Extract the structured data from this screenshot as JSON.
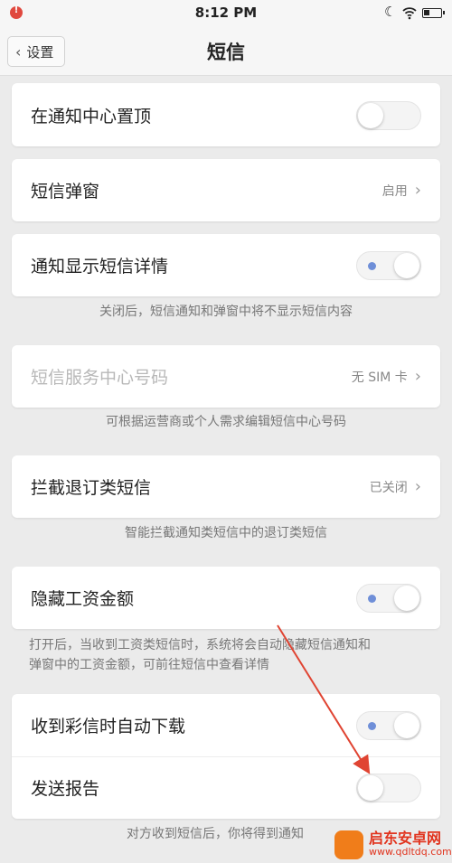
{
  "status_bar": {
    "time": "8:12 PM",
    "icons": [
      "notification-icon",
      "moon-icon",
      "wifi-icon",
      "battery-icon"
    ]
  },
  "nav": {
    "back_label": "设置",
    "title": "短信"
  },
  "settings": {
    "pin_top": {
      "label": "在通知中心置顶",
      "toggle": "off"
    },
    "popup": {
      "label": "短信弹窗",
      "value": "启用"
    },
    "show_details": {
      "label": "通知显示短信详情",
      "toggle": "on",
      "hint": "关闭后，短信通知和弹窗中将不显示短信内容"
    },
    "service_center": {
      "label": "短信服务中心号码",
      "value": "无 SIM 卡",
      "hint": "可根据运营商或个人需求编辑短信中心号码"
    },
    "block_unsubscribe": {
      "label": "拦截退订类短信",
      "value": "已关闭",
      "hint": "智能拦截通知类短信中的退订类短信"
    },
    "hide_salary": {
      "label": "隐藏工资金额",
      "toggle": "on",
      "hint_line1": "打开后，当收到工资类短信时，系统将会自动隐藏短信通知和",
      "hint_line2": "弹窗中的工资金额，可前往短信中查看详情"
    },
    "mms_auto_download": {
      "label": "收到彩信时自动下载",
      "toggle": "on"
    },
    "delivery_report": {
      "label": "发送报告",
      "toggle": "off",
      "hint": "对方收到短信后，你将得到通知"
    }
  },
  "watermark": {
    "name": "启东安卓网",
    "url": "www.qdltdq.com"
  },
  "colors": {
    "toggle_on_dot": "#6f8fd8",
    "annotation_arrow": "#e04432"
  }
}
